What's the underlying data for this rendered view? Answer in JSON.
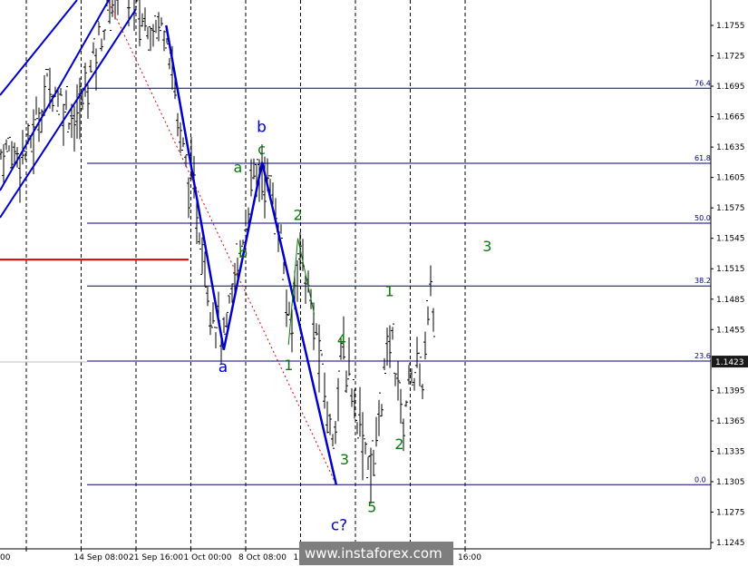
{
  "chart_data": {
    "type": "candlestick",
    "symbol_price": "1.1423",
    "y_ticks": [
      "1.1755",
      "1.1725",
      "1.1695",
      "1.1665",
      "1.1635",
      "1.1605",
      "1.1575",
      "1.1545",
      "1.1515",
      "1.1485",
      "1.1455",
      "1.1395",
      "1.1365",
      "1.1335",
      "1.1305",
      "1.1275",
      "1.1245"
    ],
    "ylim": [
      1.1232,
      1.1793
    ],
    "x_ticks": [
      {
        "label": "00",
        "t": 0
      },
      {
        "label": "14 Sep 08:00",
        "t": 1
      },
      {
        "label": "21 Sep 16:00",
        "t": 2
      },
      {
        "label": "1 Oct 00:00",
        "t": 3
      },
      {
        "label": "8 Oct 08:00",
        "t": 4
      },
      {
        "label": "15 Oct 16:00",
        "t": 5
      },
      {
        "label": "16:00",
        "t": 8
      }
    ],
    "fib_levels": [
      {
        "label": "76.4",
        "price": 1.1693
      },
      {
        "label": "61.8",
        "price": 1.1619
      },
      {
        "label": "50.0",
        "price": 1.156
      },
      {
        "label": "38.2",
        "price": 1.1498
      },
      {
        "label": "23.6",
        "price": 1.1424
      },
      {
        "label": "0.0",
        "price": 1.1302
      }
    ],
    "support_line_price": 1.1524,
    "wave_path": [
      {
        "t": 2.55,
        "price": 1.1755
      },
      {
        "t": 3.6,
        "price": 1.1435
      },
      {
        "t": 4.3,
        "price": 1.162
      },
      {
        "t": 5.65,
        "price": 1.1302
      }
    ],
    "wave_labels": {
      "blue": [
        {
          "text": "b",
          "t": 4.3,
          "price": 1.165
        },
        {
          "text": "a",
          "t": 3.6,
          "price": 1.1413
        },
        {
          "text": "c?",
          "t": 5.65,
          "price": 1.1257
        }
      ],
      "green": [
        {
          "text": "a",
          "t": 3.86,
          "price": 1.161
        },
        {
          "text": "c",
          "t": 4.3,
          "price": 1.1628
        },
        {
          "text": "b",
          "t": 3.95,
          "price": 1.1526
        },
        {
          "text": "2",
          "t": 4.95,
          "price": 1.1563
        },
        {
          "text": "1",
          "t": 4.78,
          "price": 1.1415
        },
        {
          "text": "4",
          "t": 5.75,
          "price": 1.144
        },
        {
          "text": "3",
          "t": 5.8,
          "price": 1.1322
        },
        {
          "text": "5",
          "t": 6.3,
          "price": 1.1275
        },
        {
          "text": "1",
          "t": 6.62,
          "price": 1.1488
        },
        {
          "text": "2",
          "t": 6.8,
          "price": 1.1337
        },
        {
          "text": "3",
          "t": 8.4,
          "price": 1.1532
        }
      ]
    }
  },
  "watermark": "www.instaforex.com"
}
